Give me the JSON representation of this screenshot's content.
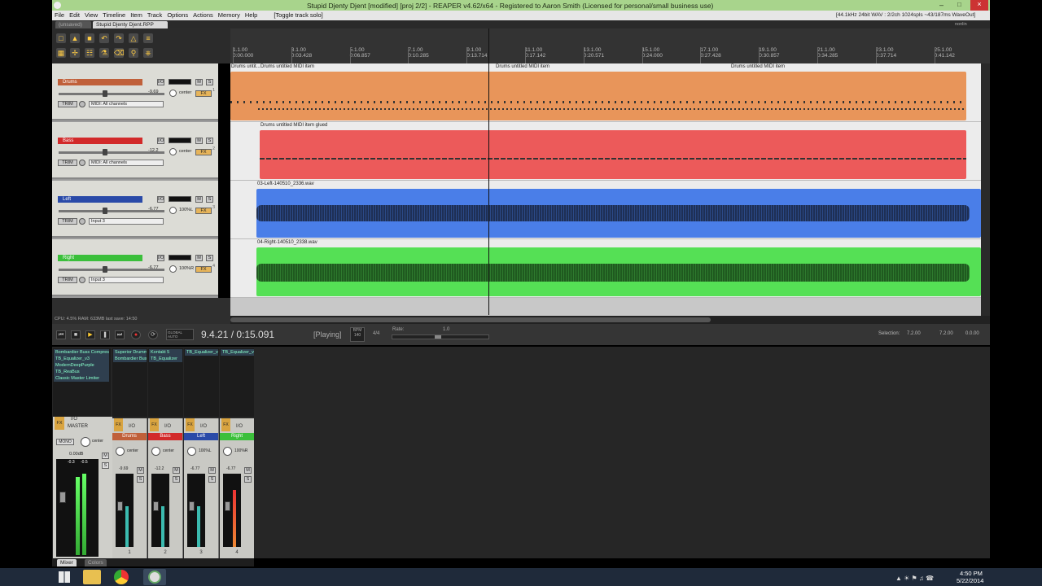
{
  "window": {
    "title": "Stupid Djenty Djent [modified] [proj 2/2] - REAPER v4.62/x64 - Registered to Aaron Smith (Licensed for personal/small business use)",
    "status": "[44.1kHz 24bit WAV : 2/2ch 1024spls ~43/187ms WaveOut]"
  },
  "menu": {
    "items": [
      "File",
      "Edit",
      "View",
      "Timeline",
      "Item",
      "Track",
      "Options",
      "Actions",
      "Memory",
      "Help",
      "[Toggle track solo]"
    ]
  },
  "tabs": [
    {
      "label": "(unsaved)"
    },
    {
      "label": "Stupid Djenty Djent.RPP"
    }
  ],
  "ruler": {
    "marks": [
      {
        "bar": "1.1.00",
        "time": "0:00.000"
      },
      {
        "bar": "3.1.00",
        "time": "0:03.428"
      },
      {
        "bar": "5.1.00",
        "time": "0:06.857"
      },
      {
        "bar": "7.1.00",
        "time": "0:10.285"
      },
      {
        "bar": "9.1.00",
        "time": "0:13.714"
      },
      {
        "bar": "11.1.00",
        "time": "0:17.142"
      },
      {
        "bar": "13.1.00",
        "time": "0:20.571"
      },
      {
        "bar": "15.1.00",
        "time": "0:24.000"
      },
      {
        "bar": "17.1.00",
        "time": "0:27.428"
      },
      {
        "bar": "19.1.00",
        "time": "0:30.857"
      },
      {
        "bar": "21.1.00",
        "time": "0:34.285"
      },
      {
        "bar": "23.1.00",
        "time": "0:37.714"
      },
      {
        "bar": "25.1.00",
        "time": "0:41.142"
      }
    ],
    "corner": "nonlin"
  },
  "tracks": [
    {
      "name": "Drums",
      "color": "#c0603a",
      "vol": "-9.69",
      "pan": "center",
      "input": "MIDI: All channels",
      "num": "1"
    },
    {
      "name": "Bass",
      "color": "#d22a2a",
      "vol": "-12.2",
      "pan": "center",
      "input": "MIDI: All channels",
      "num": "2"
    },
    {
      "name": "Left",
      "color": "#2a4aa8",
      "vol": "-6.77",
      "pan": "100%L",
      "input": "Input 3",
      "num": "3"
    },
    {
      "name": "Right",
      "color": "#3bbf3b",
      "vol": "-6.77",
      "pan": "100%R",
      "input": "Input 3",
      "num": "4"
    }
  ],
  "tcp_labels": {
    "master": "MASTER",
    "io": "I/O",
    "m": "M",
    "s": "S",
    "trim": "TRIM",
    "fx": "FX"
  },
  "items": {
    "drums": [
      {
        "label": "Drums untit..."
      },
      {
        "label": "Drums untitled MIDI item"
      },
      {
        "label": "Drums untitled MIDI item"
      },
      {
        "label": "Drums untitled MIDI item"
      }
    ],
    "bass": {
      "label": "Drums untitled MIDI item glued"
    },
    "left": {
      "label": "03-Left-140510_2336.wav"
    },
    "right": {
      "label": "04-Right-140510_2338.wav"
    }
  },
  "status_line": "CPU: 4.5%  RAM: 633MB  last save: 14:50",
  "transport": {
    "position": "9.4.21 / 0:15.091",
    "state": "[Playing]",
    "bpm_label": "BPM",
    "bpm": "140",
    "sig": "4/4",
    "rate_label": "Rate:",
    "rate": "1.0",
    "global_auto": "GLOBAL AUTO",
    "selection_label": "Selection:",
    "sel_start": "7.2.00",
    "sel_end": "7.2.00",
    "sel_len": "0.0.00"
  },
  "mixer": {
    "master": {
      "name": "MASTER",
      "vol": "0.00dB",
      "peakL": "-0.3",
      "peakR": "-0.5",
      "fx": [
        "Bombardier Buss Compres",
        "TB_Equalizer_v3",
        "ModernDeepPurple",
        "TB_ReaBus",
        "Classic Master Limiter"
      ],
      "mono": "MONO",
      "pan": "center"
    },
    "strips": [
      {
        "name": "Drums",
        "fx": [
          "Superior Drummer",
          "Bombardier Buss"
        ],
        "vol": "-9.69",
        "pan": "center",
        "num": "1"
      },
      {
        "name": "Bass",
        "fx": [
          "Kontakt 5",
          "TB_Equalizer"
        ],
        "vol": "-12.2",
        "pan": "center",
        "num": "2"
      },
      {
        "name": "Left",
        "fx": [
          "TB_Equalizer_v"
        ],
        "vol": "-6.77",
        "pan": "100%L",
        "num": "3"
      },
      {
        "name": "Right",
        "fx": [
          "TB_Equalizer_v"
        ],
        "vol": "-6.77",
        "pan": "100%R",
        "num": "4"
      }
    ],
    "tabs": [
      {
        "label": "Mixer"
      },
      {
        "label": "Colors"
      }
    ]
  },
  "taskbar": {
    "time": "4:50 PM",
    "date": "5/22/2014"
  }
}
